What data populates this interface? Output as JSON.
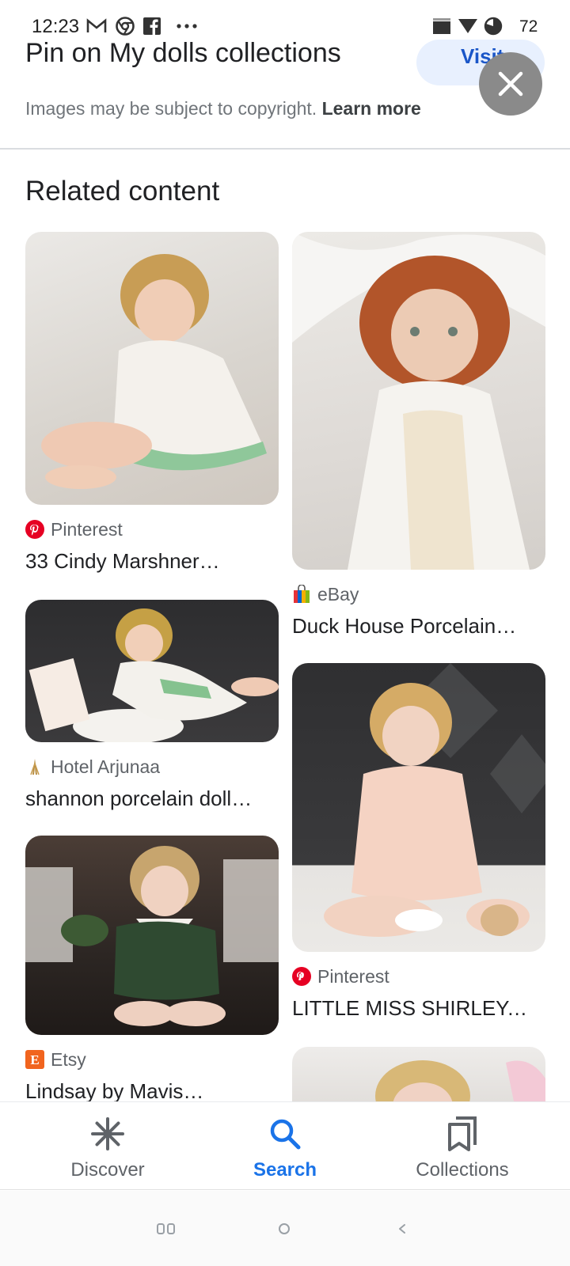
{
  "status_bar": {
    "time": "12:23",
    "battery": "72",
    "notification_icons": [
      "gmail-icon",
      "chrome-icon",
      "facebook-icon",
      "more-notifications-icon"
    ],
    "system_icons": [
      "signal-icon",
      "wifi-icon",
      "battery-icon"
    ]
  },
  "header": {
    "title": "Pin on My dolls collections",
    "visit_label": "Visit",
    "copyright_text": "Images may be subject to copyright.",
    "learn_more": "Learn more"
  },
  "related": {
    "heading": "Related content",
    "cards": [
      {
        "source": "Pinterest",
        "source_icon": "pinterest-icon",
        "title": "33 Cindy Marshner…",
        "image": "doll-photo"
      },
      {
        "source": "eBay",
        "source_icon": "ebay-icon",
        "title": "Duck House Porcelain…",
        "image": "doll-photo"
      },
      {
        "source": "Hotel Arjunaa",
        "source_icon": "hotel-icon",
        "title": "shannon porcelain doll…",
        "image": "doll-photo"
      },
      {
        "source": "Pinterest",
        "source_icon": "pinterest-icon",
        "title": "LITTLE MISS SHIRLEY.…",
        "image": "doll-photo"
      },
      {
        "source": "Etsy",
        "source_icon": "etsy-icon",
        "title": "Lindsay by Mavis…",
        "image": "doll-photo"
      },
      {
        "source": "",
        "source_icon": "",
        "title": "",
        "image": "doll-photo"
      }
    ]
  },
  "bottom_nav": {
    "items": [
      {
        "label": "Discover",
        "icon": "asterisk-icon",
        "active": false
      },
      {
        "label": "Search",
        "icon": "search-icon",
        "active": true
      },
      {
        "label": "Collections",
        "icon": "collections-icon",
        "active": false
      }
    ]
  },
  "colors": {
    "accent": "#1a73e8",
    "visit_bg": "#e8f0fe",
    "pinterest": "#e60023",
    "etsy": "#f1641e"
  }
}
